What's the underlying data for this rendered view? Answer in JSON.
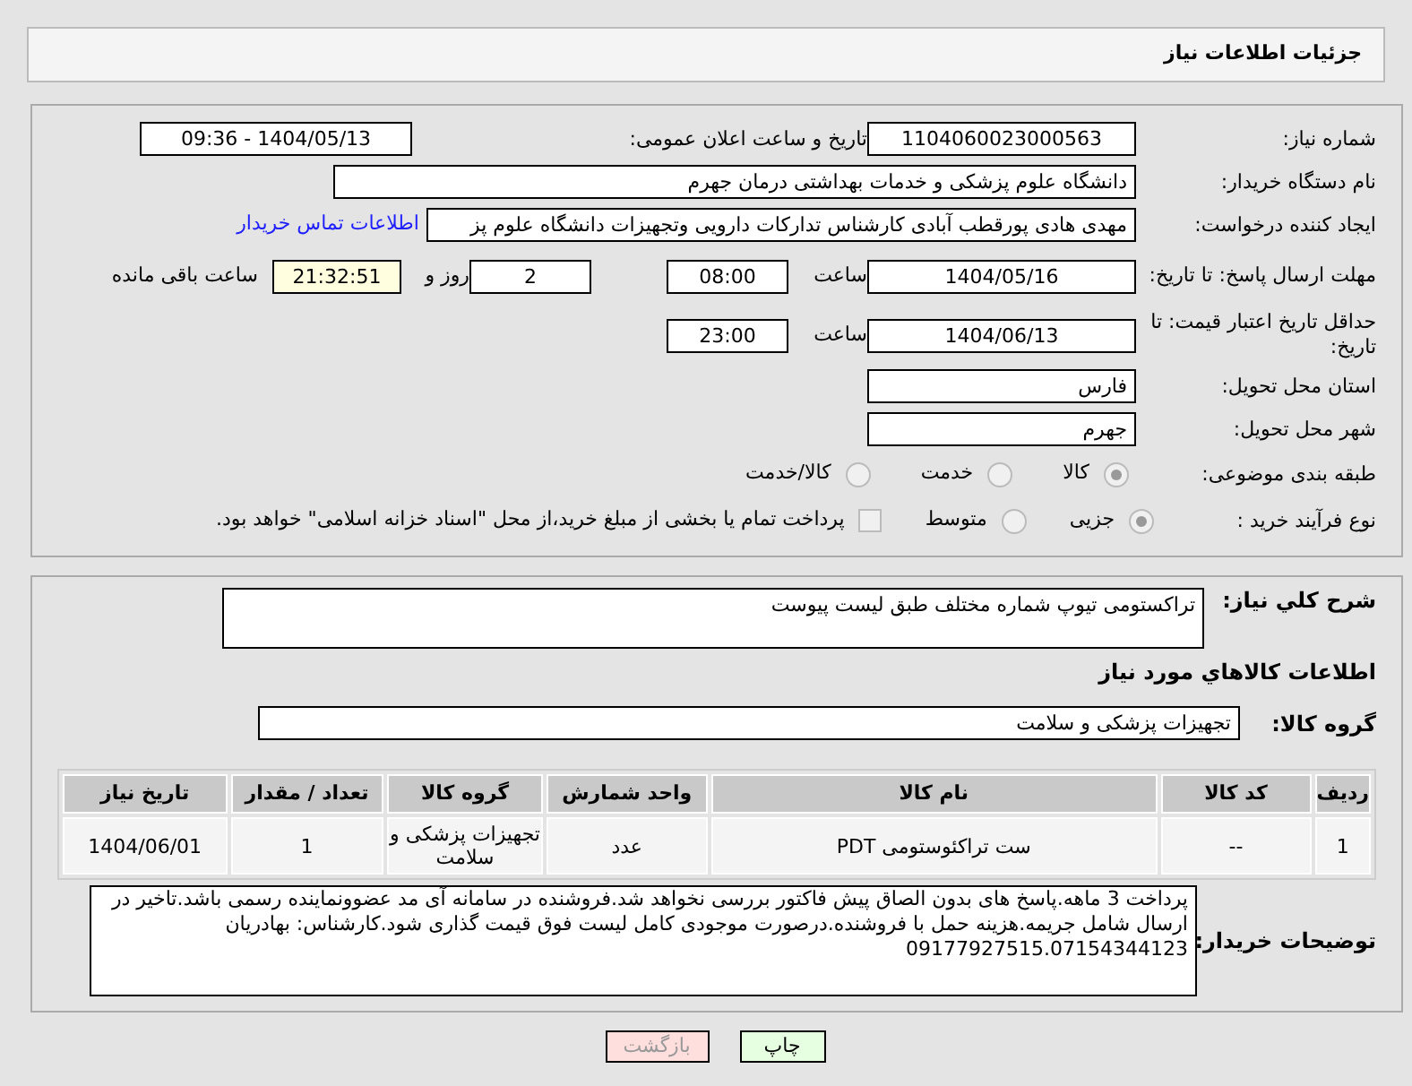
{
  "header": {
    "title": "جزئیات اطلاعات نیاز"
  },
  "need_number": {
    "label": "شماره نیاز:",
    "value": "1104060023000563"
  },
  "announce": {
    "label": "تاریخ و ساعت اعلان عمومی:",
    "value": "1404/05/13 - 09:36"
  },
  "buyer_org": {
    "label": "نام دستگاه خریدار:",
    "value": "دانشگاه علوم پزشکی و خدمات بهداشتی  درمان جهرم"
  },
  "requester": {
    "label": "ایجاد کننده درخواست:",
    "value": "مهدی هادی پورقطب آبادی کارشناس تدارکات دارویی وتجهیزات دانشگاه علوم پز",
    "link": "اطلاعات تماس خریدار"
  },
  "deadline": {
    "label": "مهلت ارسال پاسخ: تا تاریخ:",
    "date": "1404/05/16",
    "time_label": "ساعت",
    "time": "08:00",
    "days": "2",
    "days_label": "روز و",
    "remaining": "21:32:51",
    "remaining_label": "ساعت باقی مانده"
  },
  "validity": {
    "label": "حداقل تاریخ اعتبار قیمت: تا تاریخ:",
    "date": "1404/06/13",
    "time_label": "ساعت",
    "time": "23:00"
  },
  "province": {
    "label": "استان محل تحویل:",
    "value": "فارس"
  },
  "city": {
    "label": "شهر محل تحویل:",
    "value": "جهرم"
  },
  "category": {
    "label": "طبقه بندی موضوعی:",
    "options": [
      {
        "label": "کالا",
        "selected": true
      },
      {
        "label": "خدمت",
        "selected": false
      },
      {
        "label": "کالا/خدمت",
        "selected": false
      }
    ]
  },
  "process": {
    "label": "نوع فرآیند خرید :",
    "options": [
      {
        "label": "جزیی",
        "selected": true
      },
      {
        "label": "متوسط",
        "selected": false
      }
    ],
    "treasury": {
      "label": "پرداخت تمام یا بخشی از مبلغ خرید،از محل \"اسناد خزانه اسلامی\" خواهد بود.",
      "checked": false
    }
  },
  "description": {
    "label": "شرح کلي نياز:",
    "value": "تراکستومی تیوپ شماره مختلف طبق لیست پیوست"
  },
  "goods_title": "اطلاعات کالاهاي مورد نياز",
  "goods_group": {
    "label": "گروه کالا:",
    "value": "تجهیزات پزشکی و سلامت"
  },
  "table": {
    "columns": [
      "ردیف",
      "کد کالا",
      "نام کالا",
      "واحد شمارش",
      "گروه کالا",
      "تعداد / مقدار",
      "تاریخ نیاز"
    ],
    "rows": [
      [
        "1",
        "--",
        "ست تراکئوستومی PDT",
        "عدد",
        "تجهیزات پزشکی و سلامت",
        "1",
        "1404/06/01"
      ]
    ]
  },
  "buyer_notes": {
    "label": "توضیحات خریدار:",
    "value": "پرداخت 3 ماهه.پاسخ های بدون الصاق پیش فاکتور بررسی نخواهد شد.فروشنده در سامانه آی مد عضوونماینده رسمی باشد.تاخیر در ارسال شامل جریمه.هزینه حمل با فروشنده.درصورت موجودی کامل لیست فوق قیمت گذاری شود.کارشناس: بهادریان 09177927515.07154344123"
  },
  "buttons": [
    {
      "label": "چاپ",
      "kind": "print"
    },
    {
      "label": "بازگشت",
      "kind": "back"
    }
  ]
}
